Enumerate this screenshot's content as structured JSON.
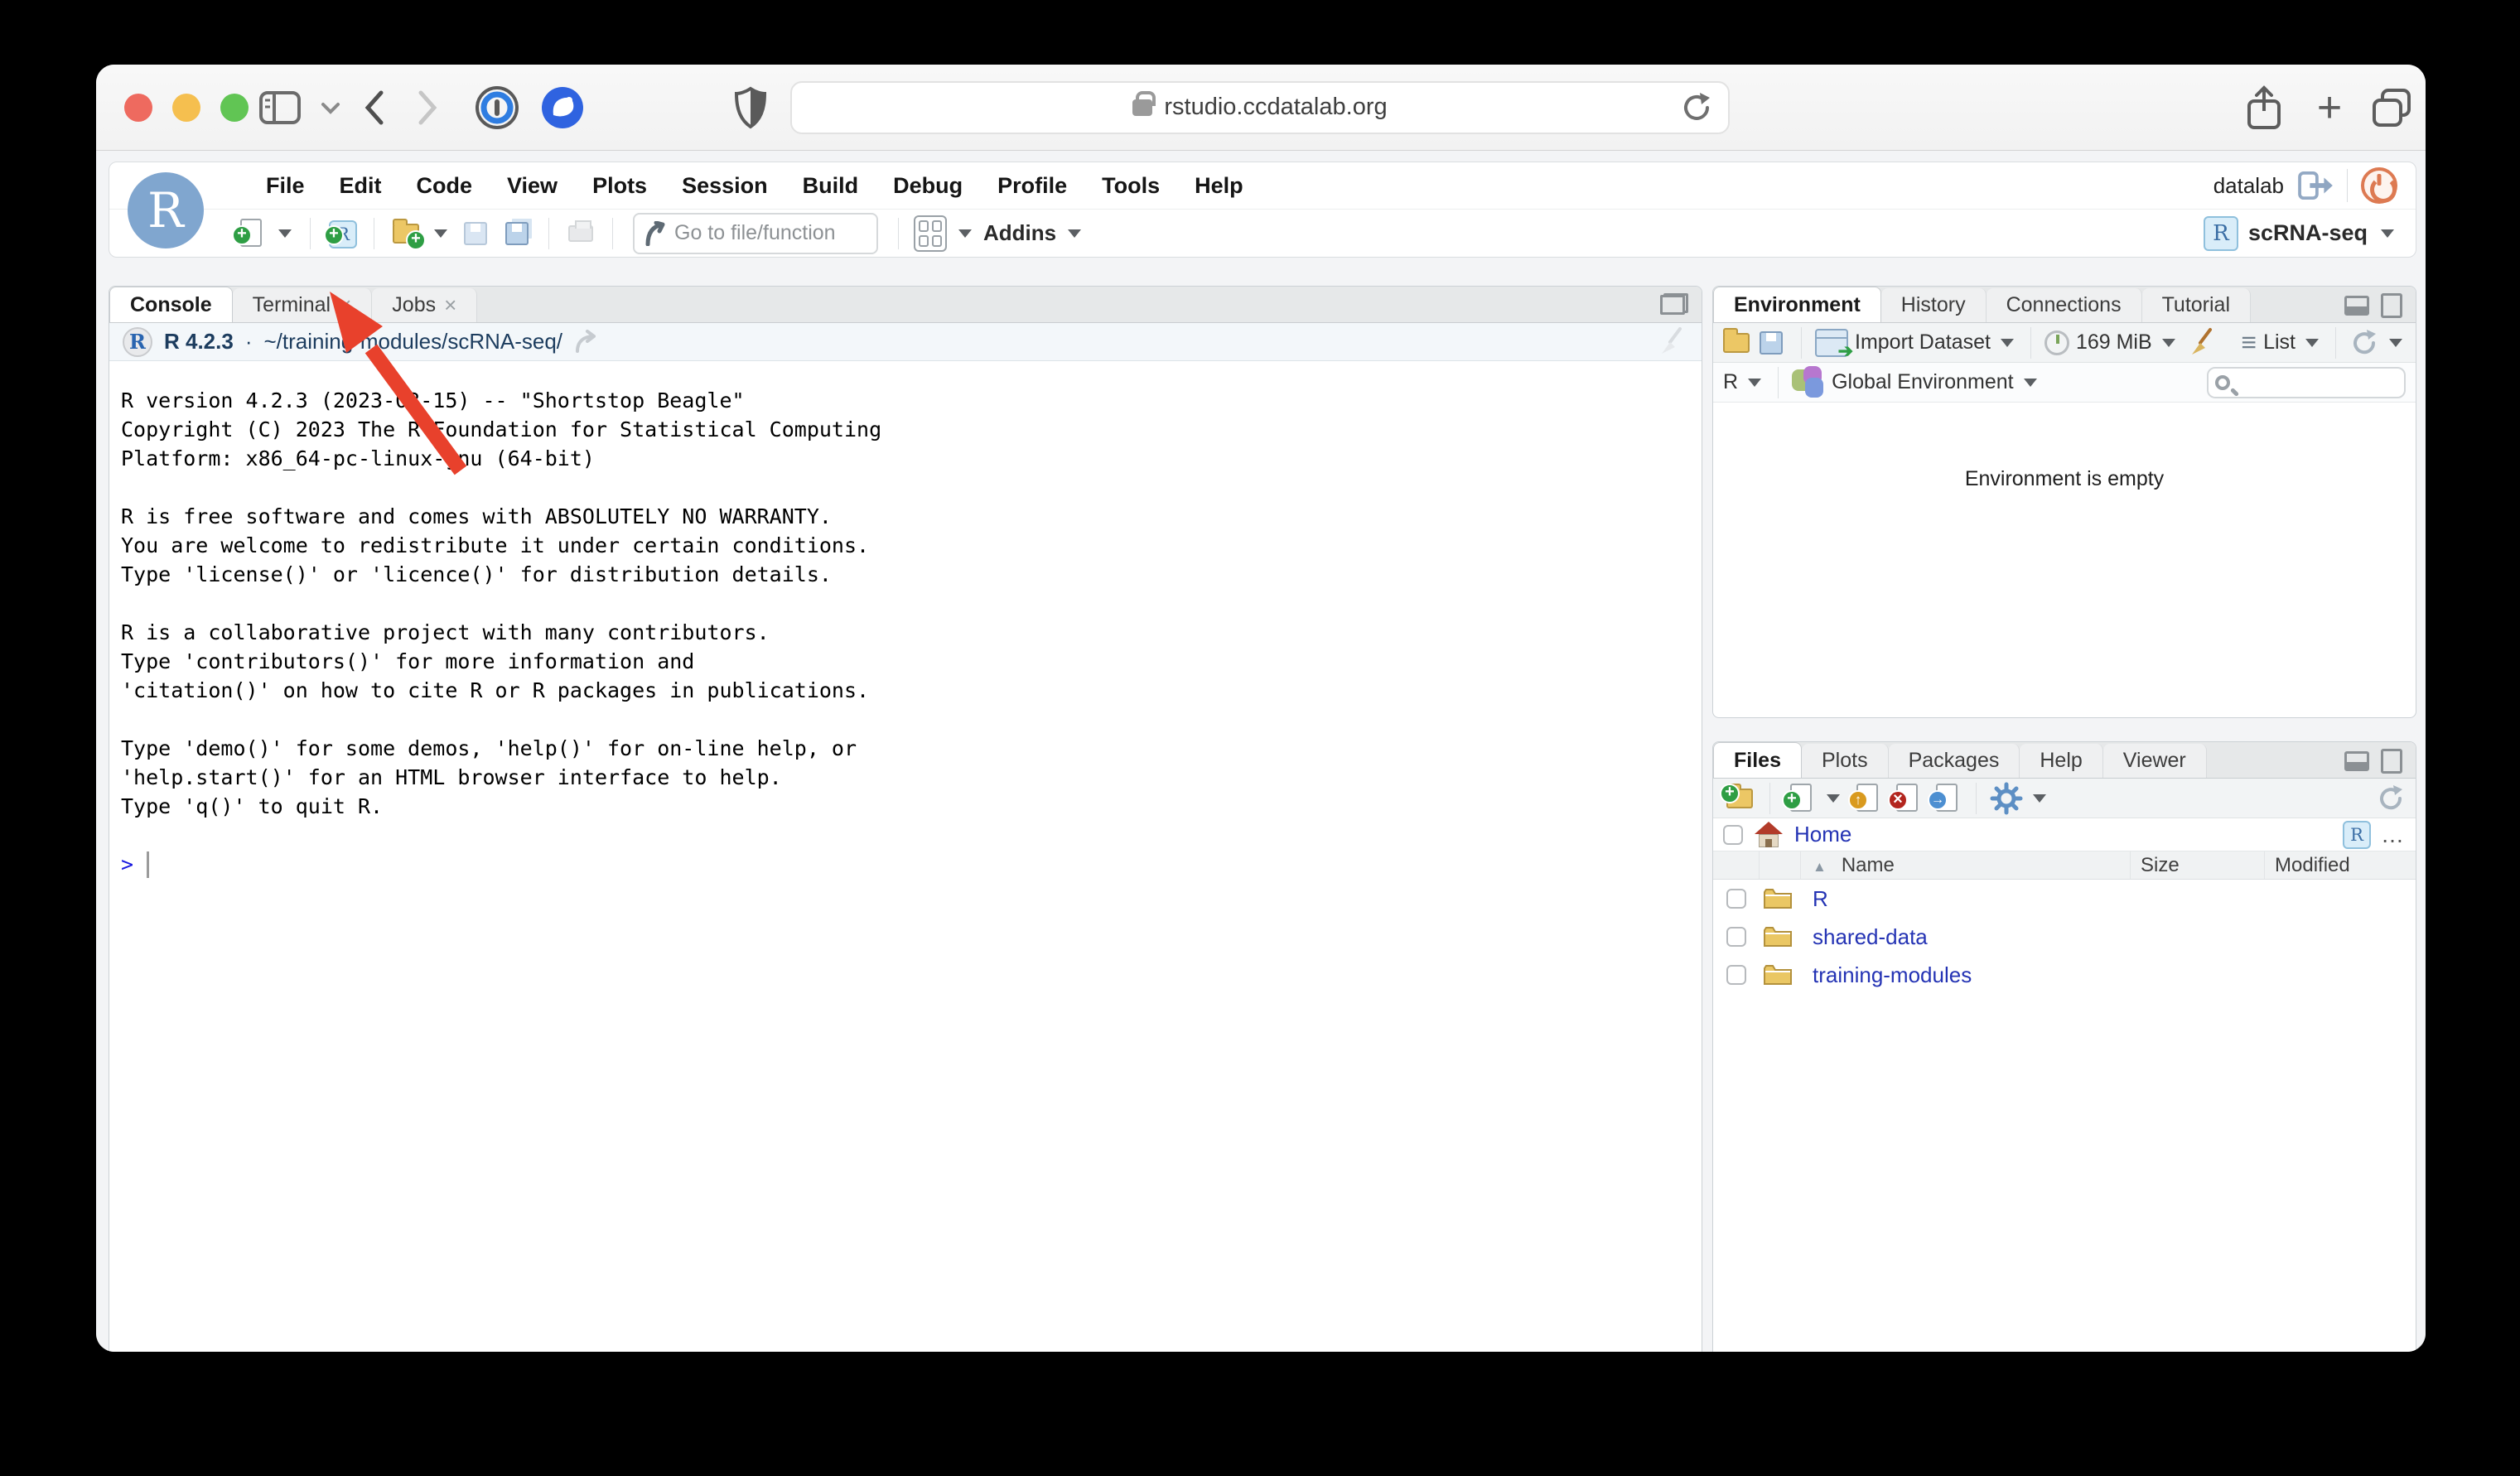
{
  "browser": {
    "url": "rstudio.ccdatalab.org",
    "traffic_lights": [
      "close",
      "minimize",
      "zoom"
    ]
  },
  "menu": {
    "items": [
      "File",
      "Edit",
      "Code",
      "View",
      "Plots",
      "Session",
      "Build",
      "Debug",
      "Profile",
      "Tools",
      "Help"
    ],
    "user": "datalab"
  },
  "toolbar": {
    "goto_placeholder": "Go to file/function",
    "addins_label": "Addins",
    "project_label": "scRNA-seq"
  },
  "console": {
    "tabs": [
      "Console",
      "Terminal",
      "Jobs"
    ],
    "r_version": "R 4.2.3",
    "separator": "·",
    "working_dir": "~/training-modules/scRNA-seq/",
    "lines": [
      "R version 4.2.3 (2023-03-15) -- \"Shortstop Beagle\"",
      "Copyright (C) 2023 The R Foundation for Statistical Computing",
      "Platform: x86_64-pc-linux-gnu (64-bit)",
      "",
      "R is free software and comes with ABSOLUTELY NO WARRANTY.",
      "You are welcome to redistribute it under certain conditions.",
      "Type 'license()' or 'licence()' for distribution details.",
      "",
      "R is a collaborative project with many contributors.",
      "Type 'contributors()' for more information and",
      "'citation()' on how to cite R or R packages in publications.",
      "",
      "Type 'demo()' for some demos, 'help()' for on-line help, or",
      "'help.start()' for an HTML browser interface to help.",
      "Type 'q()' to quit R.",
      ""
    ],
    "prompt": ">"
  },
  "environment": {
    "tabs": [
      "Environment",
      "History",
      "Connections",
      "Tutorial"
    ],
    "import_dataset_label": "Import Dataset",
    "memory_usage": "169 MiB",
    "list_label": "List",
    "language_selector": "R",
    "scope_selector": "Global Environment",
    "empty_message": "Environment is empty"
  },
  "files": {
    "tabs": [
      "Files",
      "Plots",
      "Packages",
      "Help",
      "Viewer"
    ],
    "breadcrumb": "Home",
    "columns": {
      "name": "Name",
      "size": "Size",
      "modified": "Modified"
    },
    "rows": [
      {
        "name": "R",
        "size": "",
        "modified": ""
      },
      {
        "name": "shared-data",
        "size": "",
        "modified": ""
      },
      {
        "name": "training-modules",
        "size": "",
        "modified": ""
      }
    ]
  },
  "annotation": {
    "type": "red-arrow",
    "points_at": "Terminal tab"
  },
  "colors": {
    "arrow_red": "#e8412c",
    "link_blue": "#2433b4",
    "logo_blue": "#80a6cf",
    "traffic_red": "#ee6a5f",
    "traffic_yellow": "#f5bf4f",
    "traffic_green": "#61c554",
    "power_orange": "#dd7a52"
  }
}
